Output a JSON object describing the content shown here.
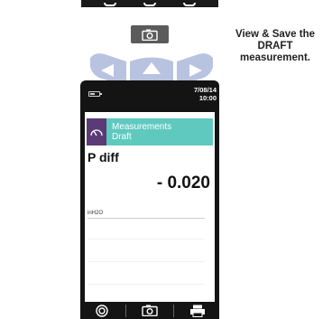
{
  "instruction": {
    "text": "View & Save the DRAFT measurement."
  },
  "device": {
    "status": {
      "date": "7/08/14",
      "time": "10:00"
    },
    "header": {
      "line1": "Measurements",
      "line2": "Draft",
      "color": "#5fc9c0",
      "icon_tile_color": "#5a3b75"
    },
    "measurement": {
      "parameter": "P diff",
      "value": "- 0.020",
      "unit": "inH2O"
    },
    "bottom_bar": {
      "buttons": [
        "target-icon",
        "camera-icon",
        "printer-icon"
      ]
    }
  },
  "accent": {
    "arrows_color": "#b8c3e0"
  }
}
